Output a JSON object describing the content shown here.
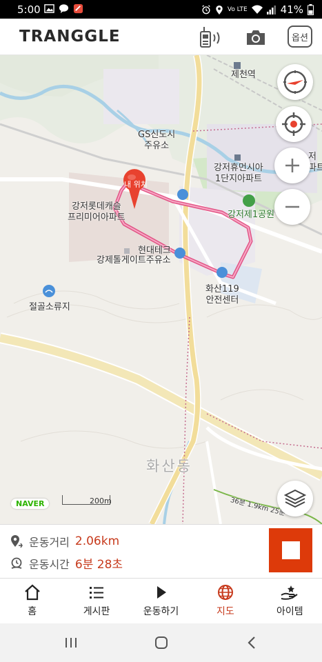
{
  "status_bar": {
    "time": "5:00",
    "network": "Vo LTE",
    "battery": "41%"
  },
  "header": {
    "logo": "TRANGGLE",
    "options_label": "옵션",
    "icons": [
      "walkie-talkie-icon",
      "camera-icon"
    ]
  },
  "map": {
    "labels": {
      "jecheon_station": "제천역",
      "gs_station": "GS신도시\n주유소",
      "gangjeo_apt": "강저휴먼시아\n1단지아파트",
      "gangjeo_park": "강저제1공원",
      "lotte_apt": "강저롯데캐슬\n프리미어아파트",
      "my_location": "내 위치",
      "hyundai": "현대테크",
      "toll_gas": "강제톨게이트주유소",
      "fire_center": "화산119\n안전센터",
      "reservoir": "절골소류지",
      "hwasan_dong": "화산동",
      "edge_label": "저\n파트",
      "trail_label": "36분 1.9km 25분"
    },
    "naver_logo": "NAVER",
    "scale": "200m",
    "accent_colors": {
      "route": "#e0457b",
      "marker": "#e8422f"
    }
  },
  "stats": {
    "distance_label": "운동거리",
    "distance_value": "2.06km",
    "time_label": "운동시간",
    "time_value": "6분 28초"
  },
  "bottom_nav": {
    "items": [
      {
        "label": "홈",
        "icon": "home-icon"
      },
      {
        "label": "게시판",
        "icon": "list-icon"
      },
      {
        "label": "운동하기",
        "icon": "play-icon"
      },
      {
        "label": "지도",
        "icon": "globe-icon",
        "active": true
      },
      {
        "label": "아이템",
        "icon": "item-hand-icon"
      }
    ]
  }
}
